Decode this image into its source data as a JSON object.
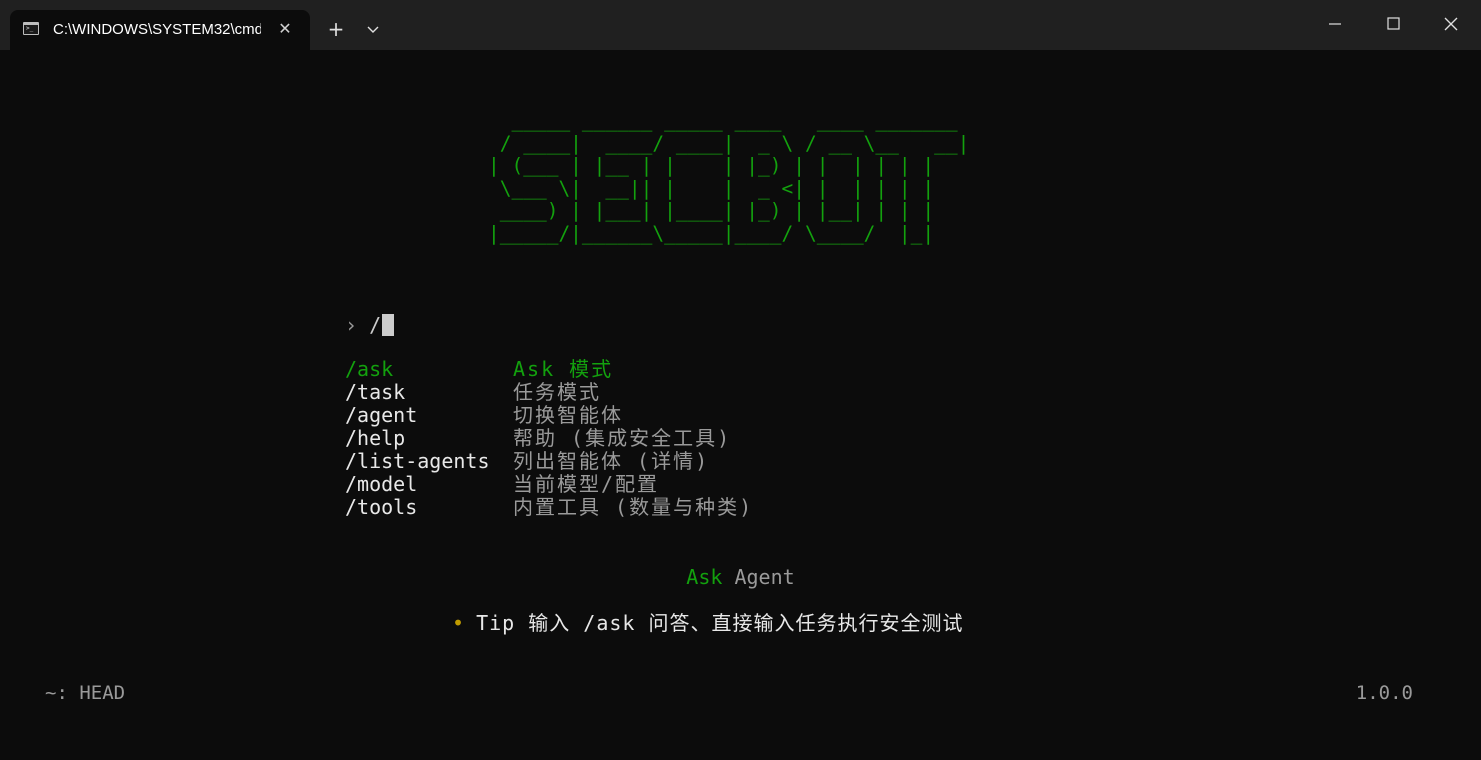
{
  "window": {
    "tab_title": "C:\\WINDOWS\\SYSTEM32\\cmd",
    "tab_icon": "terminal-icon",
    "controls": [
      "new-tab-icon",
      "chevron-down-icon",
      "minimize-icon",
      "maximize-icon",
      "close-icon"
    ]
  },
  "terminal": {
    "banner_lines": [
      "  _____ ______ _____ ____   ____ _______ ",
      " / ____|  ____/ ____|  _ \\ / __ \\__   __|",
      "| (___ | |__ | |    | |_) | |  | | | |   ",
      " \\___ \\|  __|| |    |  _ <| |  | | | |   ",
      " ____) | |___| |____| |_) | |__| | | |   ",
      "|_____/|______\\_____|____/ \\____/  |_|   "
    ],
    "prompt": {
      "arrow": "›",
      "input": "/"
    },
    "commands": [
      {
        "name": "/ask",
        "desc": "Ask 模式",
        "selected": true
      },
      {
        "name": "/task",
        "desc": "任务模式",
        "selected": false
      },
      {
        "name": "/agent",
        "desc": "切换智能体",
        "selected": false
      },
      {
        "name": "/help",
        "desc": "帮助 (集成安全工具)",
        "selected": false
      },
      {
        "name": "/list-agents",
        "desc": "列出智能体 (详情)",
        "selected": false
      },
      {
        "name": "/model",
        "desc": "当前模型/配置",
        "selected": false
      },
      {
        "name": "/tools",
        "desc": "内置工具 (数量与种类)",
        "selected": false
      }
    ],
    "agent": {
      "name": "Ask",
      "suffix": "Agent"
    },
    "tip": {
      "bullet": "•",
      "text": "Tip 输入 /ask 问答、直接输入任务执行安全测试"
    },
    "status": {
      "left": "~: HEAD",
      "right": "1.0.0"
    }
  },
  "colors": {
    "background": "#0c0c0c",
    "titlebar": "#202020",
    "accent_green": "#13a10e",
    "muted": "#9a9a9a",
    "bullet": "#c19c00"
  }
}
